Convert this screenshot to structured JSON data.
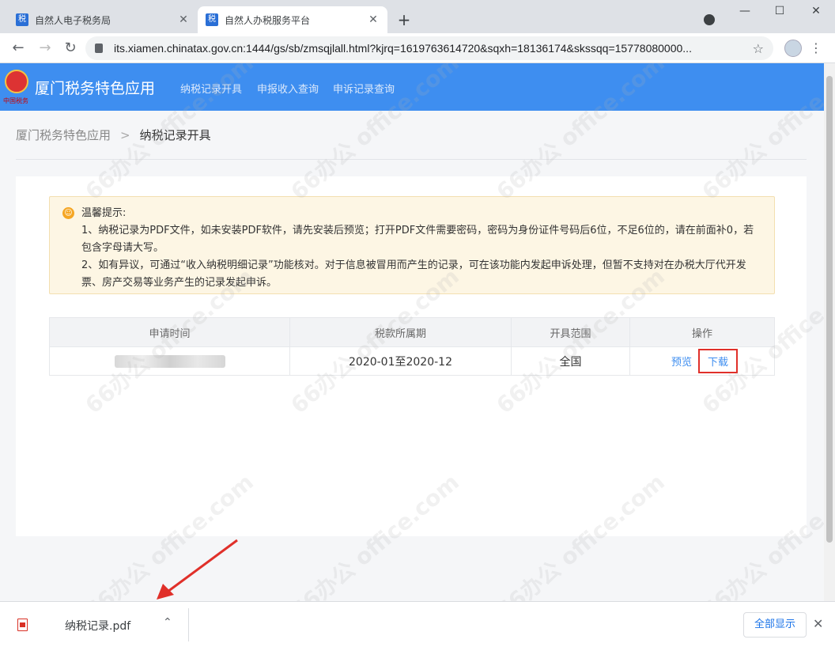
{
  "browser": {
    "tabs": [
      {
        "favicon": "税",
        "title": "自然人电子税务局",
        "active": false
      },
      {
        "favicon": "税",
        "title": "自然人办税服务平台",
        "active": true
      }
    ],
    "url": "its.xiamen.chinatax.gov.cn:1444/gs/sb/zmsqjlall.html?kjrq=1619763614720&sqxh=18136174&skssqq=15778080000..."
  },
  "header": {
    "title": "厦门税务特色应用",
    "emblem_text": "中国税务",
    "nav": [
      "纳税记录开具",
      "申报收入查询",
      "申诉记录查询"
    ],
    "color": "#3e8ef0"
  },
  "breadcrumb": {
    "root": "厦门税务特色应用",
    "separator": ">",
    "current": "纳税记录开具"
  },
  "notice": {
    "title": "温馨提示:",
    "line1": "1、纳税记录为PDF文件，如未安装PDF软件，请先安装后预览；打开PDF文件需要密码，密码为身份证件号码后6位，不足6位的，请在前面补0，若包含字母请大写。",
    "line2": "2、如有异议，可通过“收入纳税明细记录”功能核对。对于信息被冒用而产生的记录，可在该功能内发起申诉处理，但暂不支持对在办税大厅代开发票、房产交易等业务产生的记录发起申诉。"
  },
  "table": {
    "headers": [
      "申请时间",
      "税款所属期",
      "开具范围",
      "操作"
    ],
    "rows": [
      {
        "period": "2020-01至2020-12",
        "scope": "全国",
        "preview": "预览",
        "download": "下载"
      }
    ]
  },
  "download_shelf": {
    "file_name": "纳税记录.pdf",
    "show_all": "全部显示"
  },
  "watermark": "66办公 office.com"
}
